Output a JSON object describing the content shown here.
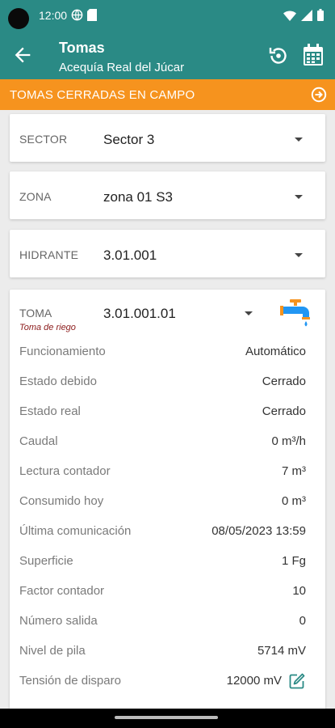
{
  "status_bar": {
    "time": "12:00"
  },
  "app_bar": {
    "title": "Tomas",
    "subtitle": "Acequía Real del Júcar"
  },
  "banner": {
    "text": "TOMAS CERRADAS EN CAMPO"
  },
  "selectors": {
    "sector": {
      "label": "SECTOR",
      "value": "Sector 3"
    },
    "zona": {
      "label": "ZONA",
      "value": "zona 01 S3"
    },
    "hidrante": {
      "label": "HIDRANTE",
      "value": "3.01.001"
    }
  },
  "toma": {
    "label": "TOMA",
    "sublabel": "Toma de riego",
    "value": "3.01.001.01",
    "rows": [
      {
        "label": "Funcionamiento",
        "value": "Automático"
      },
      {
        "label": "Estado debido",
        "value": "Cerrado"
      },
      {
        "label": "Estado real",
        "value": "Cerrado"
      },
      {
        "label": "Caudal",
        "value": "0 m³/h"
      },
      {
        "label": "Lectura contador",
        "value": "7 m³"
      },
      {
        "label": "Consumido hoy",
        "value": "0 m³"
      },
      {
        "label": "Última comunicación",
        "value": "08/05/2023 13:59"
      },
      {
        "label": "Superficie",
        "value": "1 Fg"
      },
      {
        "label": "Factor contador",
        "value": "10"
      },
      {
        "label": "Número salida",
        "value": "0"
      },
      {
        "label": "Nivel de pila",
        "value": "5714 mV"
      },
      {
        "label": "Tensión de disparo",
        "value": "12000 mV"
      }
    ]
  },
  "colors": {
    "primary": "#2a8a85",
    "accent": "#f6931e",
    "faucet_blue": "#2196f3",
    "faucet_orange": "#f6931e",
    "edit_icon": "#2a8a85"
  },
  "icons": {
    "back": "arrow-left-icon",
    "history": "history-icon",
    "calendar": "calendar-icon",
    "banner": "arrow-right-circle-icon",
    "toma": "faucet-icon",
    "edit": "edit-icon"
  }
}
